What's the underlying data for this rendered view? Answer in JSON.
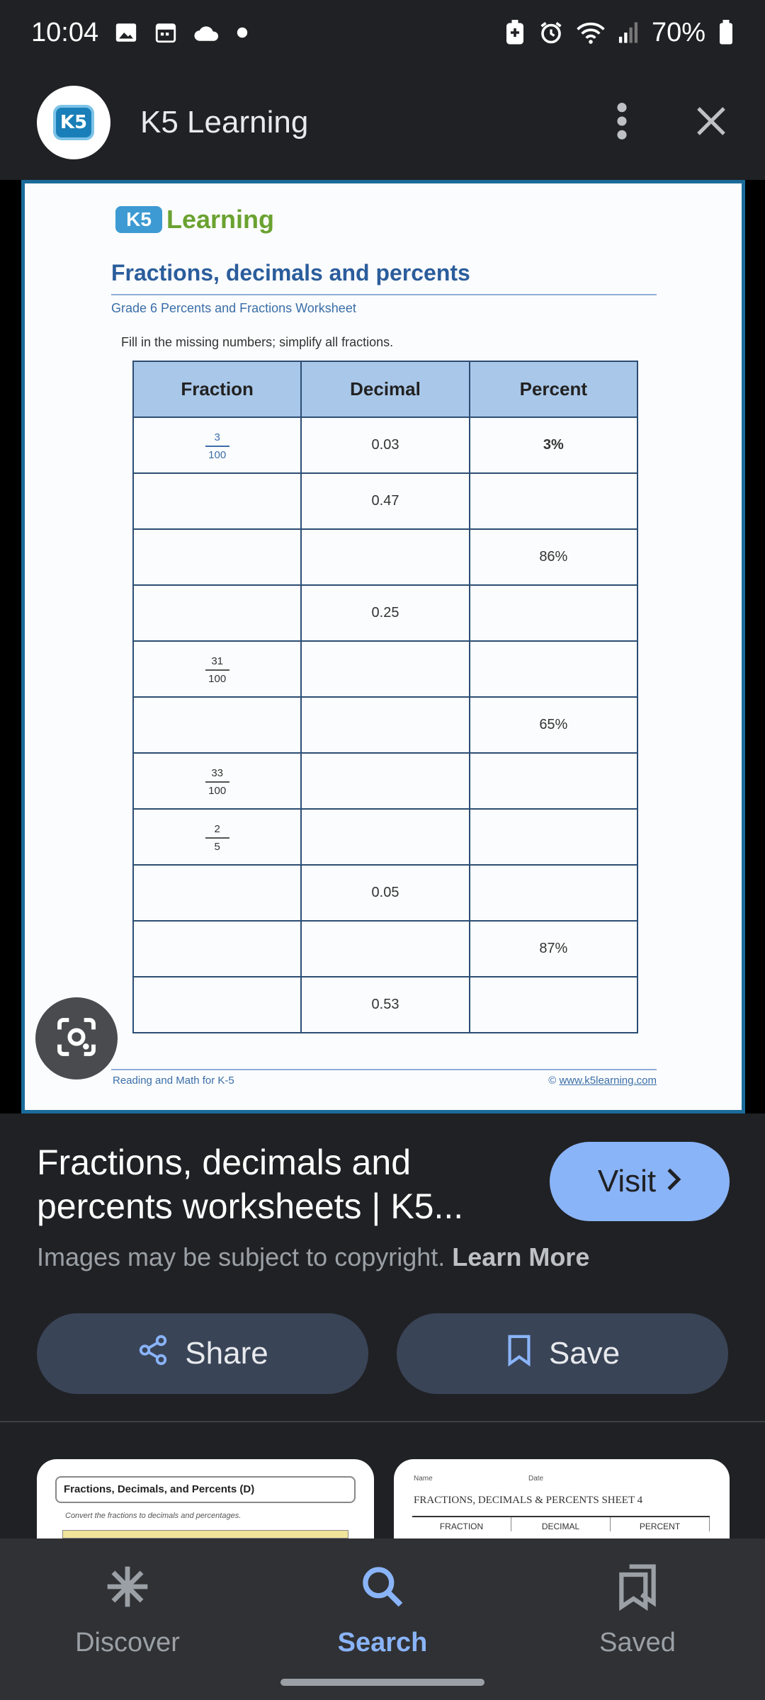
{
  "status_bar": {
    "time": "10:04",
    "battery": "70%",
    "icons_left": [
      "gallery-icon",
      "calendar-icon",
      "cloud-icon",
      "dot-icon"
    ],
    "icons_right": [
      "battery-saver-icon",
      "alarm-icon",
      "wifi-icon",
      "signal-icon",
      "battery-icon"
    ]
  },
  "header": {
    "site_name": "K5 Learning",
    "avatar_text": "K5"
  },
  "worksheet": {
    "logo_badge": "K5",
    "logo_word": "Learning",
    "title": "Fractions, decimals and percents",
    "subtitle": "Grade 6 Percents and Fractions Worksheet",
    "instructions": "Fill in the missing numbers; simplify all fractions.",
    "columns": [
      "Fraction",
      "Decimal",
      "Percent"
    ],
    "rows": [
      {
        "num": "3",
        "den": "100",
        "decimal": "0.03",
        "percent": "3%"
      },
      {
        "num": "",
        "den": "",
        "decimal": "0.47",
        "percent": ""
      },
      {
        "num": "",
        "den": "",
        "decimal": "",
        "percent": "86%"
      },
      {
        "num": "",
        "den": "",
        "decimal": "0.25",
        "percent": ""
      },
      {
        "num": "31",
        "den": "100",
        "decimal": "",
        "percent": ""
      },
      {
        "num": "",
        "den": "",
        "decimal": "",
        "percent": "65%"
      },
      {
        "num": "33",
        "den": "100",
        "decimal": "",
        "percent": ""
      },
      {
        "num": "2",
        "den": "5",
        "decimal": "",
        "percent": ""
      },
      {
        "num": "",
        "den": "",
        "decimal": "0.05",
        "percent": ""
      },
      {
        "num": "",
        "den": "",
        "decimal": "",
        "percent": "87%"
      },
      {
        "num": "",
        "den": "",
        "decimal": "0.53",
        "percent": ""
      }
    ],
    "footer_left": "Reading and Math for K-5",
    "footer_copyright": "©",
    "footer_link": "www.k5learning.com"
  },
  "result": {
    "title": "Fractions, decimals and percents worksheets | K5...",
    "visit_label": "Visit",
    "copyright_text": "Images may be subject to copyright.",
    "learn_more": "Learn More",
    "share_label": "Share",
    "save_label": "Save"
  },
  "related": {
    "thumb1_title": "Fractions, Decimals, and Percents (D)",
    "thumb1_sub": "Convert the fractions to decimals and percentages.",
    "thumb2_name": "Name",
    "thumb2_date": "Date",
    "thumb2_title": "FRACTIONS, DECIMALS & PERCENTS SHEET 4",
    "thumb2_cols": [
      "FRACTION",
      "DECIMAL",
      "PERCENT"
    ]
  },
  "bottom_nav": {
    "items": [
      {
        "label": "Discover",
        "icon": "asterisk-icon",
        "active": false
      },
      {
        "label": "Search",
        "icon": "search-icon",
        "active": true
      },
      {
        "label": "Saved",
        "icon": "bookmarks-icon",
        "active": false
      }
    ]
  },
  "colors": {
    "background": "#202124",
    "accent": "#8ab4f8",
    "button": "#394457"
  }
}
